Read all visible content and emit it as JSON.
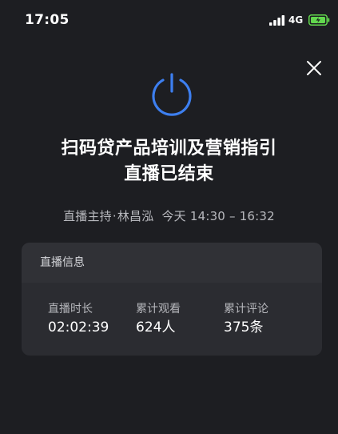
{
  "status_bar": {
    "time": "17:05",
    "network": "4G"
  },
  "close": {
    "icon": "close-icon"
  },
  "status_icon": "power-icon",
  "live_status": {
    "title": "扫码贷产品培训及营销指引",
    "subtitle": "直播已结束"
  },
  "meta": {
    "host_label": "直播主持",
    "separator": "·",
    "host_name": "林昌泓",
    "date_label": "今天",
    "time_range": "14:30 – 16:32"
  },
  "info_card": {
    "header": "直播信息",
    "stats": [
      {
        "label": "直播时长",
        "value": "02:02:39"
      },
      {
        "label": "累计观看",
        "value": "624人"
      },
      {
        "label": "累计评论",
        "value": "375条"
      }
    ]
  },
  "colors": {
    "background": "#1d1e22",
    "card": "#2b2c31",
    "accent_blue": "#3d7ff0",
    "battery_green": "#62d84e"
  }
}
